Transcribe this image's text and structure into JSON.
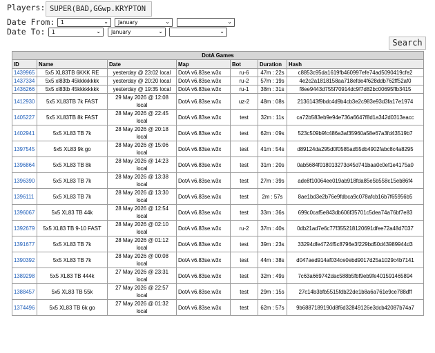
{
  "filters": {
    "players_label": "Players:",
    "players_value": "SUPER(BAD,GGwp.KRYPTON",
    "date_from_label": "Date From:",
    "date_to_label": "Date To:",
    "from_day": "1",
    "from_month": "January",
    "from_year": "",
    "to_day": "1",
    "to_month": "January",
    "to_year": "",
    "search_label": "Search"
  },
  "table": {
    "caption": "DotA Games",
    "headers": [
      "ID",
      "Name",
      "Date",
      "Map",
      "Bot",
      "Duration",
      "Hash"
    ],
    "rows": [
      {
        "id": "1439965",
        "name": "5x5 XL83TB 6KKK RE",
        "date1": "yesterday @ 23:02 local",
        "date2": "",
        "map": "DotA v6.83se.w3x",
        "bot": "ru-6",
        "duration": "47m : 22s",
        "hash": "c8853c95da1619fb460997efe74ad5090419cfe2"
      },
      {
        "id": "1437334",
        "name": "5x5 xl83tb 45kkkkkkkk",
        "date1": "yesterday @ 20:20 local",
        "date2": "",
        "map": "DotA v6.83se.w3x",
        "bot": "ru-2",
        "duration": "57m : 19s",
        "hash": "4e2c2a1818158aa718efde4f628ddb762ff52af0"
      },
      {
        "id": "1436266",
        "name": "5x5 xl83tb 45kkkkkkkk",
        "date1": "yesterday @ 19:35 local",
        "date2": "",
        "map": "DotA v6.83se.w3x",
        "bot": "ru-1",
        "duration": "38m : 31s",
        "hash": "f8ee9443d755f70914dc9f7d82bc00695ffb3415"
      },
      {
        "id": "1412930",
        "name": "5x5 XL83TB 7k FAST",
        "date1": "29 May 2026 @ 12:08",
        "date2": "local",
        "map": "DotA v6.83se.w3x",
        "bot": "uz-2",
        "duration": "48m : 08s",
        "hash": "2136143f9bdc4d9b4cb3e2c983e93d3fa17e1974"
      },
      {
        "id": "1405227",
        "name": "5x5 XL83TB 8k FAST",
        "date1": "28 May 2026 @ 22:45",
        "date2": "local",
        "map": "DotA v6.83se.w3x",
        "bot": "test",
        "duration": "32m : 11s",
        "hash": "ca72b583eb9e94e736a6647f8d1a342d0313eacc"
      },
      {
        "id": "1402941",
        "name": "5x5 XL83 TB 7k",
        "date1": "28 May 2026 @ 20:18",
        "date2": "local",
        "map": "DotA v6.83se.w3x",
        "bot": "test",
        "duration": "62m : 09s",
        "hash": "523c509b9fc486a3af35960a58e67a3fd43519b7"
      },
      {
        "id": "1397545",
        "name": "5x5 XL83 9k go",
        "date1": "28 May 2026 @ 15:06",
        "date2": "local",
        "map": "DotA v6.83se.w3x",
        "bot": "test",
        "duration": "41m : 54s",
        "hash": "d89124da295d0f0585ad55db4902fabc8c4a8295"
      },
      {
        "id": "1396864",
        "name": "5x5 XL83 TB 8k",
        "date1": "28 May 2026 @ 14:23",
        "date2": "local",
        "map": "DotA v6.83se.w3x",
        "bot": "test",
        "duration": "31m : 20s",
        "hash": "0ab5684f018013273d45d741baa0c0ef1e4175a0"
      },
      {
        "id": "1396390",
        "name": "5x5 XL83 TB 7k",
        "date1": "28 May 2026 @ 13:38",
        "date2": "local",
        "map": "DotA v6.83se.w3x",
        "bot": "test",
        "duration": "27m : 39s",
        "hash": "ade8f10064ee019ab918fda85e5b558c15eb86f4"
      },
      {
        "id": "1396111",
        "name": "5x5 XL83 TB 7k",
        "date1": "28 May 2026 @ 13:30",
        "date2": "local",
        "map": "DotA v6.83se.w3x",
        "bot": "test",
        "duration": "2m : 57s",
        "hash": "8ae1bd3e2b76e9fdbca9c078afcb16b7f65956b5"
      },
      {
        "id": "1396067",
        "name": "5x5 XL83 TB 44k",
        "date1": "28 May 2026 @ 12:54",
        "date2": "local",
        "map": "DotA v6.83se.w3x",
        "bot": "test",
        "duration": "33m : 36s",
        "hash": "699c0caf5e843db606f35701c5dea74a76bf7e83"
      },
      {
        "id": "1392679",
        "name": "5x5 XL83 TB 9-10 FAST",
        "date1": "28 May 2026 @ 02:10",
        "date2": "local",
        "map": "DotA v6.83se.w3x",
        "bot": "ru-2",
        "duration": "37m : 40s",
        "hash": "0db21ad7e6c77f355218120691dfee72a48d7037"
      },
      {
        "id": "1391677",
        "name": "5x5 XL83 TB 7k",
        "date1": "28 May 2026 @ 01:12",
        "date2": "local",
        "map": "DotA v6.83se.w3x",
        "bot": "test",
        "duration": "39m : 23s",
        "hash": "33294dfe4724f5c8796e3f229bd50d43989944d3"
      },
      {
        "id": "1390392",
        "name": "5x5 XL83 TB 7k",
        "date1": "28 May 2026 @ 00:08",
        "date2": "local",
        "map": "DotA v6.83se.w3x",
        "bot": "test",
        "duration": "44m : 38s",
        "hash": "d047aed914af034ce0ebd9017d25a1029c4b7141"
      },
      {
        "id": "1389298",
        "name": "5x5 XL83 TB 444k",
        "date1": "27 May 2026 @ 23:31",
        "date2": "local",
        "map": "DotA v6.83se.w3x",
        "bot": "test",
        "duration": "32m : 49s",
        "hash": "7c63a669742dac588b5fbf9eb9fe401591465894"
      },
      {
        "id": "1388457",
        "name": "5x5 XL83 TB 55k",
        "date1": "27 May 2026 @ 22:57",
        "date2": "local",
        "map": "DotA v6.83se.w3x",
        "bot": "test",
        "duration": "29m : 15s",
        "hash": "27c14b3bfb5515fdb22de1b8a6a761e9ce788dff"
      },
      {
        "id": "1374496",
        "name": "5x5 XL83 TB 6k go",
        "date1": "27 May 2026 @ 01:32",
        "date2": "local",
        "map": "DotA v6.83se.w3x",
        "bot": "test",
        "duration": "62m : 57s",
        "hash": "9b6887189190d8f6d32849126e3dcb42087b74a7"
      }
    ]
  },
  "colors": {
    "link": "#1a5bb8",
    "caption_bg": "#d6d6d6",
    "header_bg": "#ececec"
  }
}
